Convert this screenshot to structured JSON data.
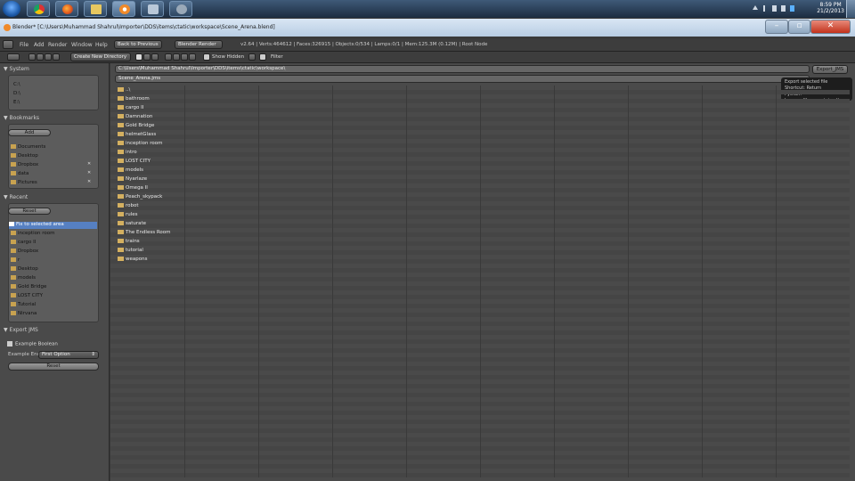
{
  "taskbar": {
    "clock": {
      "time": "8:59 PM",
      "date": "21/2/2013"
    }
  },
  "window": {
    "title": "Blender* [C:\\Users\\Muhammad Shahrul\\Importer\\DDS\\items\\ctatic\\workspace\\Scene_Arena.blend]"
  },
  "header": {
    "menu": [
      "File",
      "Add",
      "Render",
      "Window",
      "Help"
    ],
    "back_button": "Back to Previous",
    "render_engine": "Blender Render",
    "stats": "v2.64 | Verts:464612 | Faces:326915 | Objects:0/534 | Lamps:0/1 | Mem:125.3M (0.12M) | Root Node"
  },
  "filebrowser": {
    "create_dir": "Create New Directory",
    "show_hidden": "Show Hidden",
    "filter": "Filter",
    "path": "C:\\Users\\Muhammad Shahrul\\Importer\\DDS\\items\\ctatic\\workspace\\",
    "filename": "Scene_Arena.jms",
    "export_button": "Export_JMS",
    "tooltip": [
      "Export selected file",
      "Shortcut: Return",
      "Python: bpy.ops.file.export_jms()"
    ],
    "parent": "..\\",
    "folders": [
      "bathroom",
      "cargo II",
      "Damnation",
      "Gold Bridge",
      "helmetGlass",
      "inception room",
      "intro",
      "LOST CITY",
      "models",
      "Nyarlaze",
      "Omega II",
      "Peach_skypack",
      "robot",
      "rules",
      "saturate",
      "The Endless Room",
      "trains",
      "tutorial",
      "weapons"
    ]
  },
  "sidebar": {
    "system": {
      "title": "System",
      "drives": [
        "C:\\",
        "D:\\",
        "E:\\"
      ]
    },
    "bookmarks": {
      "title": "Bookmarks",
      "add": "Add",
      "items": [
        "Documents",
        "Desktop",
        "Dropbox",
        "data",
        "Pictures"
      ]
    },
    "recent": {
      "title": "Recent",
      "reset": "Reset",
      "items": [
        "Fix to selected area",
        "inception room",
        "cargo II",
        "Dropbox",
        "r",
        "Desktop",
        "models",
        "Gold Bridge",
        "LOST CITY",
        "Tutorial",
        "Nirvana"
      ]
    },
    "export": {
      "title": "Export JMS",
      "checkbox": "Example Boolean",
      "enum_label": "Example Enum:",
      "enum_value": "First Option",
      "reset": "Reset"
    }
  }
}
